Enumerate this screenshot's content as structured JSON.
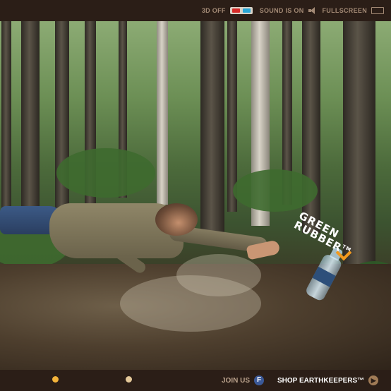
{
  "topbar": {
    "three_d_label": "3D OFF",
    "three_d_icon": "3d-glasses-icon",
    "sound_label": "SOUND IS ON",
    "sound_icon": "speaker-icon",
    "fullscreen_label": "FULLSCREEN",
    "fullscreen_icon": "fullscreen-icon"
  },
  "hero": {
    "brand_line1": "GREEN",
    "brand_line2": "RUBBER",
    "brand_tm": "TM",
    "accent_color": "#f39a1e"
  },
  "bottombar": {
    "slides": [
      {
        "state": "active"
      },
      {
        "state": "inactive"
      }
    ],
    "join_label": "JOIN US",
    "join_icon": "facebook-icon",
    "shop_label": "SHOP EARTHKEEPERS™",
    "shop_icon": "arrow-right-icon"
  },
  "colors": {
    "bar_bg": "#2b1e17",
    "bar_text": "#a38a75",
    "active_dot": "#f3b33a"
  }
}
